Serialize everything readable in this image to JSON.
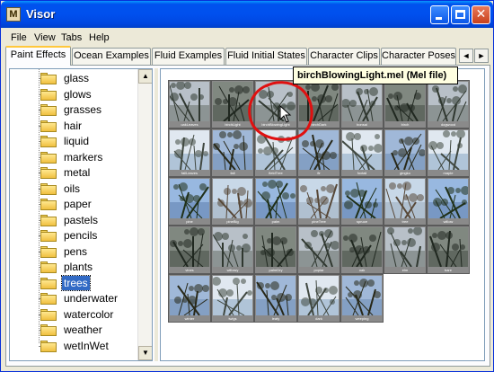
{
  "window": {
    "title": "Visor",
    "app_icon_letter": "M"
  },
  "title_buttons": {
    "minimize": "minimize-icon",
    "maximize": "maximize-icon",
    "close": "close-icon"
  },
  "menu": [
    "File",
    "View",
    "Tabs",
    "Help"
  ],
  "tabs": [
    {
      "label": "Paint Effects",
      "active": true
    },
    {
      "label": "Ocean Examples",
      "active": false
    },
    {
      "label": "Fluid Examples",
      "active": false
    },
    {
      "label": "Fluid Initial States",
      "active": false
    },
    {
      "label": "Character Clips",
      "active": false
    },
    {
      "label": "Character Poses",
      "active": false
    }
  ],
  "tab_scroll": {
    "left": "◄",
    "right": "►"
  },
  "tree": {
    "items": [
      "glass",
      "glows",
      "grasses",
      "hair",
      "liquid",
      "markers",
      "metal",
      "oils",
      "paper",
      "pastels",
      "pencils",
      "pens",
      "plants",
      "trees",
      "underwater",
      "watercolor",
      "weather",
      "wetInWet"
    ],
    "selected": "trees"
  },
  "scroll": {
    "up": "▲",
    "down": "▼"
  },
  "tooltip": "birchBlowingLight.mel (Mel file)",
  "thumbnails": {
    "rows": [
      [
        {
          "cap": "oakLeaves"
        },
        {
          "cap": "birchLight"
        },
        {
          "cap": "birchBlowingLight"
        },
        {
          "cap": "birchDark"
        },
        {
          "cap": "bonsai"
        },
        {
          "cap": "birch"
        },
        {
          "cap": "dogwood"
        }
      ],
      [
        {
          "cap": "fallLeaves"
        },
        {
          "cap": "fall"
        },
        {
          "cap": "fieldTree"
        },
        {
          "cap": "fir"
        },
        {
          "cap": "foxtail"
        },
        {
          "cap": "gingko"
        },
        {
          "cap": "maple"
        }
      ],
      [
        {
          "cap": "pine"
        },
        {
          "cap": "pineBig"
        },
        {
          "cap": "palm"
        },
        {
          "cap": "pineTree"
        },
        {
          "cap": "spruce"
        },
        {
          "cap": "tree"
        },
        {
          "cap": "willow"
        }
      ],
      [
        {
          "cap": "vines"
        },
        {
          "cap": "willowy"
        },
        {
          "cap": "palmDry"
        },
        {
          "cap": "poplar"
        },
        {
          "cap": "oak"
        },
        {
          "cap": "elm"
        },
        {
          "cap": "bare"
        }
      ],
      [
        {
          "cap": "winter"
        },
        {
          "cap": "twigs"
        },
        {
          "cap": "leafy"
        },
        {
          "cap": "dark"
        },
        {
          "cap": "weeping"
        }
      ]
    ]
  },
  "colors": {
    "titlebar": "#0050ee",
    "selection": "#316ac5",
    "tooltip": "#ffffe1",
    "annotation": "#e01010"
  }
}
